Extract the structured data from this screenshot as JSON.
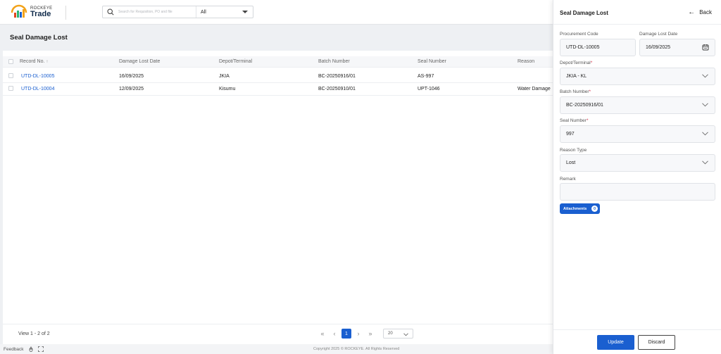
{
  "app": {
    "logo_top": "ROCKEYE",
    "logo_main": "Trade"
  },
  "search": {
    "placeholder": "Search for Requisition, PO and file",
    "scope": "All"
  },
  "page": {
    "title": "Seal Damage Lost"
  },
  "table": {
    "columns": [
      "Record No.",
      "Damage Lost Date",
      "Depot/Terminal",
      "Batch Number",
      "Seal Number",
      "Reason"
    ],
    "sort_indicator": "↑",
    "rows": [
      {
        "record": "UTD-DL-10005",
        "date": "16/09/2025",
        "depot": "JKIA",
        "batch": "BC-20250916/01",
        "seal": "AS-997",
        "reason": ""
      },
      {
        "record": "UTD-DL-10004",
        "date": "12/09/2025",
        "depot": "Kisumu",
        "batch": "BC-20250910/01",
        "seal": "UPT-1046",
        "reason": "Water Damage"
      }
    ]
  },
  "pagination": {
    "view_text": "View 1 - 2 of 2",
    "first": "«",
    "prev": "‹",
    "current": "1",
    "next": "›",
    "last": "»",
    "page_size": "20"
  },
  "status_bar": {
    "feedback": "Feedback",
    "copyright": "Copyright 2025 © ROCKEYE. All Rights Reserved"
  },
  "panel": {
    "title": "Seal Damage Lost",
    "back_label": "Back",
    "procurement_code_label": "Procurement Code",
    "procurement_code": "UTD-DL-10005",
    "damage_lost_date_label": "Damage Lost Date",
    "damage_lost_date": "16/09/2025",
    "depot_label": "Depot/Terminal",
    "depot_value": "JKIA - KL",
    "batch_label": "Batch Number",
    "batch_value": "BC-20250916/01",
    "seal_label": "Seal Number",
    "seal_value": "997",
    "reason_type_label": "Reason Type",
    "reason_type_value": "Lost",
    "remark_label": "Remark",
    "remark_value": "",
    "attachments_label": "Attachments",
    "attachments_count": "0",
    "required_mark": "*",
    "update_label": "Update",
    "discard_label": "Discard"
  },
  "colors": {
    "accent": "#1a5fd0",
    "link": "#1a5fd0",
    "required": "#d9304a"
  }
}
